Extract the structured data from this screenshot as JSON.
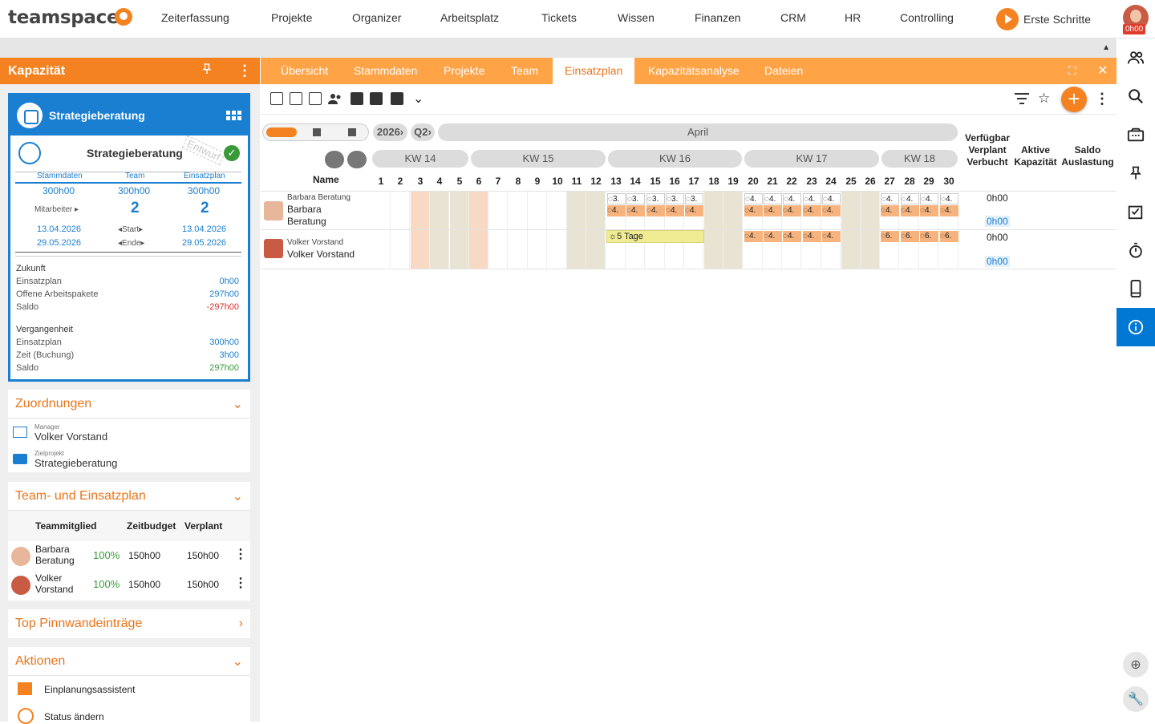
{
  "app": {
    "logo": "teamspace",
    "nav": [
      "Zeiterfassung",
      "Projekte",
      "Organizer",
      "Arbeitsplatz",
      "Tickets",
      "Wissen",
      "Finanzen",
      "CRM",
      "HR",
      "Controlling"
    ],
    "erste_schritte": "Erste Schritte",
    "user_time": "0h00"
  },
  "left": {
    "title": "Kapazität",
    "card": {
      "head_title": "Strategieberatung",
      "name": "Strategieberatung",
      "stamp": "Entwurf",
      "cols": [
        "Stammdaten",
        "Team",
        "Einsatzplan"
      ],
      "hours": [
        "300h00",
        "300h00",
        "300h00"
      ],
      "mitarbeiter_label": "Mitarbeiter ▸",
      "mitarbeiter": [
        "2",
        "2"
      ],
      "start": [
        "13.04.2026",
        "13.04.2026"
      ],
      "start_label": "◂Start▸",
      "end": [
        "29.05.2026",
        "29.05.2026"
      ],
      "end_label": "◂Ende▸",
      "zukunft_label": "Zukunft",
      "zukunft": [
        {
          "label": "Einsatzplan",
          "value": "0h00",
          "color": "#1a7fd0"
        },
        {
          "label": "Offene Arbeitspakete",
          "value": "297h00",
          "color": "#1a7fd0"
        },
        {
          "label": "Saldo",
          "value": "-297h00",
          "color": "#d9302c"
        }
      ],
      "vergangenheit_label": "Vergangenheit",
      "vergangenheit": [
        {
          "label": "Einsatzplan",
          "value": "300h00",
          "color": "#1a7fd0"
        },
        {
          "label": "Zeit (Buchung)",
          "value": "3h00",
          "color": "#1a7fd0"
        },
        {
          "label": "Saldo",
          "value": "297h00",
          "color": "#3a9a3a"
        }
      ]
    },
    "zuordnungen": {
      "title": "Zuordnungen",
      "manager_label": "Manager",
      "manager": "Volker Vorstand",
      "ziel_label": "Zielprojekt",
      "ziel": "Strategieberatung"
    },
    "team": {
      "title": "Team- und Einsatzplan",
      "headers": [
        "Teammitglied",
        "Zeitbudget",
        "Verplant"
      ],
      "rows": [
        {
          "name1": "Barbara",
          "name2": "Beratung",
          "pct": "100%",
          "budget": "150h00",
          "verplant": "150h00"
        },
        {
          "name1": "Volker",
          "name2": "Vorstand",
          "pct": "100%",
          "budget": "150h00",
          "verplant": "150h00"
        }
      ]
    },
    "pinnwand": "Top Pinnwandeinträge",
    "aktionen": {
      "title": "Aktionen",
      "items": [
        "Einplanungsassistent",
        "Status ändern"
      ]
    }
  },
  "tabs": [
    "Übersicht",
    "Stammdaten",
    "Projekte",
    "Team",
    "Einsatzplan",
    "Kapazitätsanalyse",
    "Dateien"
  ],
  "planner": {
    "year": "2026›",
    "quarter": "Q2›",
    "month": "April",
    "weeks": [
      "KW 14",
      "KW 15",
      "KW 16",
      "KW 17",
      "KW 18"
    ],
    "name_header": "Name",
    "days": [
      "1",
      "2",
      "3",
      "4",
      "5",
      "6",
      "7",
      "8",
      "9",
      "10",
      "11",
      "12",
      "13",
      "14",
      "15",
      "16",
      "17",
      "18",
      "19",
      "20",
      "21",
      "22",
      "23",
      "24",
      "25",
      "26",
      "27",
      "28",
      "29",
      "30"
    ],
    "right_headers": {
      "verfuegbar": "Verfügbar",
      "verplant": "Verplant",
      "verbucht": "Verbucht",
      "aktive": "Aktive",
      "kapazitaet": "Kapazität",
      "saldo": "Saldo",
      "auslastung": "Auslastung"
    },
    "rows": [
      {
        "small": "Barbara Beratung",
        "name1": "Barbara",
        "name2": "Beratung",
        "v1": "0h00",
        "v2": "0h00"
      },
      {
        "small": "Volker Vorstand",
        "name1": "Volker Vorstand",
        "name2": "",
        "v1": "0h00",
        "v2": "0h00"
      }
    ],
    "vacation_label": "5 Tage",
    "cell_top_label": "3.",
    "cell_bot_label": "4.",
    "cell_wk17_label": "4.",
    "cell_wk18_label": "6."
  }
}
